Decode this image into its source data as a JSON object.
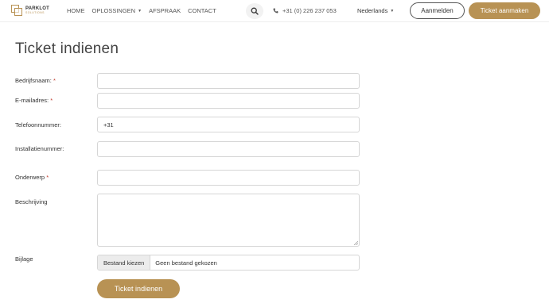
{
  "header": {
    "logo_name": "PARKLOT",
    "logo_sub": "SOLUTIONS",
    "nav": [
      {
        "label": "HOME"
      },
      {
        "label": "OPLOSSINGEN"
      },
      {
        "label": "AFSPRAAK"
      },
      {
        "label": "CONTACT"
      }
    ],
    "phone": "+31 (0) 226 237 053",
    "language": "Nederlands",
    "login_label": "Aanmelden",
    "ticket_label": "Ticket aanmaken",
    "icons": {
      "search": "search-icon",
      "phone": "phone-icon",
      "caret": "chevron-down-icon"
    }
  },
  "page": {
    "title": "Ticket indienen"
  },
  "form": {
    "company_label": "Bedrijfsnaam:",
    "email_label": "E-mailadres:",
    "required_mark": "*",
    "phone_label": "Telefoonnummer:",
    "phone_value": "+31",
    "installation_label": "Installatienummer:",
    "subject_label": "Onderwerp",
    "description_label": "Beschrijving",
    "attachment_label": "Bijlage",
    "file_button": "Bestand kiezen",
    "file_status": "Geen bestand gekozen",
    "submit_label": "Ticket indienen"
  },
  "colors": {
    "accent": "#b89254",
    "required": "#c0392b"
  }
}
